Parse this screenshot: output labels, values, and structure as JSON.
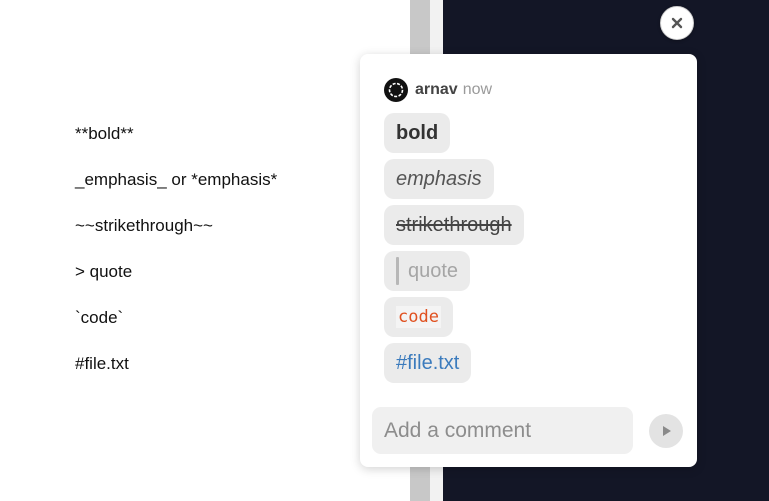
{
  "editor": {
    "lines": [
      "**bold**",
      "_emphasis_ or *emphasis*",
      "~~strikethrough~~",
      "> quote",
      "`code`",
      "#file.txt"
    ]
  },
  "comment": {
    "author": "arnav",
    "time": "now",
    "chips": {
      "bold": "bold",
      "emphasis": "emphasis",
      "strikethrough": "strikethrough",
      "quote": "quote",
      "code": "code",
      "file": "#file.txt"
    }
  },
  "composer": {
    "placeholder": "Add a comment",
    "value": ""
  },
  "icons": {
    "close": "close-icon",
    "send": "send-icon",
    "avatar": "avatar-icon"
  },
  "colors": {
    "code_text": "#e0501f",
    "file_link": "#3b7bbd",
    "dark_pane": "#131626"
  }
}
